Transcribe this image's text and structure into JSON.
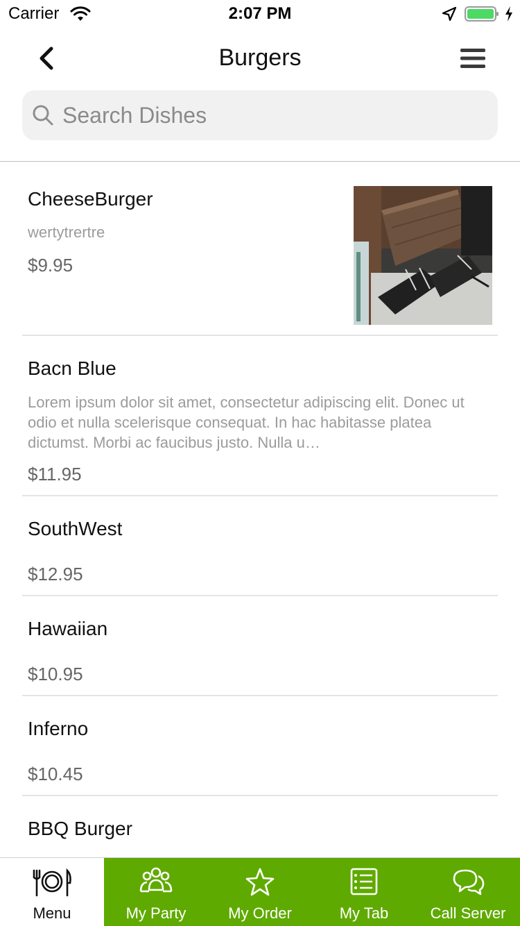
{
  "status_bar": {
    "carrier": "Carrier",
    "time": "2:07 PM"
  },
  "nav": {
    "title": "Burgers",
    "back_icon": "chevron-left-icon",
    "menu_icon": "hamburger-menu-icon"
  },
  "search": {
    "placeholder": "Search Dishes",
    "value": ""
  },
  "dishes": [
    {
      "name": "CheeseBurger",
      "description": "wertytrertre",
      "price": "$9.95",
      "has_photo": true
    },
    {
      "name": "Bacn Blue",
      "description": "Lorem ipsum dolor sit amet, consectetur adipiscing elit. Donec ut odio et nulla scelerisque consequat. In hac habitasse platea dictumst. Morbi ac faucibus justo. Nulla u…",
      "price": "$11.95",
      "has_photo": false
    },
    {
      "name": "SouthWest",
      "description": "",
      "price": "$12.95",
      "has_photo": false
    },
    {
      "name": "Hawaiian",
      "description": "",
      "price": "$10.95",
      "has_photo": false
    },
    {
      "name": "Inferno",
      "description": "",
      "price": "$10.45",
      "has_photo": false
    },
    {
      "name": "BBQ Burger",
      "description": "",
      "price": "",
      "has_photo": false
    }
  ],
  "tabs": [
    {
      "label": "Menu",
      "icon": "plate-cutlery-icon",
      "active": true
    },
    {
      "label": "My Party",
      "icon": "group-icon",
      "active": false
    },
    {
      "label": "My Order",
      "icon": "star-icon",
      "active": false
    },
    {
      "label": "My Tab",
      "icon": "list-icon",
      "active": false
    },
    {
      "label": "Call Server",
      "icon": "chat-bubbles-icon",
      "active": false
    }
  ],
  "colors": {
    "tab_green": "#5faa00",
    "battery_green": "#4cd964"
  }
}
